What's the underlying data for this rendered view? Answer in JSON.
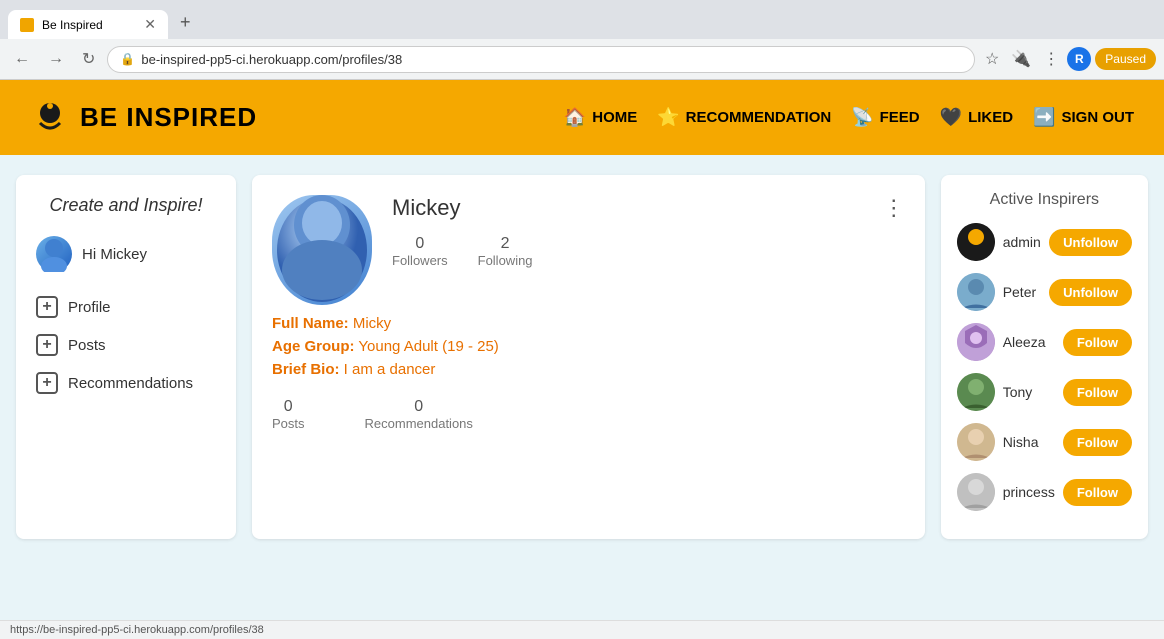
{
  "browser": {
    "tab_title": "Be Inspired",
    "tab_favicon": "🏠",
    "url": "be-inspired-pp5-ci.herokuapp.com/profiles/38",
    "new_tab_label": "+",
    "nav_back": "←",
    "nav_forward": "→",
    "nav_refresh": "↻",
    "status_url": "https://be-inspired-pp5-ci.herokuapp.com/profiles/38",
    "profile_letter": "R",
    "paused_label": "Paused"
  },
  "navbar": {
    "logo_text": "BE INSPIRED",
    "nav_items": [
      {
        "id": "home",
        "icon": "🏠",
        "label": "HOME"
      },
      {
        "id": "recommendation",
        "icon": "⭐",
        "label": "RECOMMENDATION"
      },
      {
        "id": "feed",
        "icon": "📡",
        "label": "FEED"
      },
      {
        "id": "liked",
        "icon": "🖤",
        "label": "LIKED"
      },
      {
        "id": "signout",
        "icon": "🚪",
        "label": "SIGN OUT"
      }
    ]
  },
  "sidebar": {
    "title": "Create and Inspire!",
    "user_greeting": "Hi Mickey",
    "menu_items": [
      {
        "id": "profile",
        "label": "Profile"
      },
      {
        "id": "posts",
        "label": "Posts"
      },
      {
        "id": "recommendations",
        "label": "Recommendations"
      }
    ]
  },
  "profile": {
    "name": "Mickey",
    "followers_count": "0",
    "followers_label": "Followers",
    "following_count": "2",
    "following_label": "Following",
    "full_name_label": "Full Name:",
    "full_name_value": "Micky",
    "age_group_label": "Age Group:",
    "age_group_value": "Young Adult (19 - 25)",
    "bio_label": "Brief Bio:",
    "bio_value": "I am a dancer",
    "posts_count": "0",
    "posts_label": "Posts",
    "recommendations_count": "0",
    "recommendations_label": "Recommendations"
  },
  "inspirers": {
    "title": "Active Inspirers",
    "items": [
      {
        "id": "admin",
        "name": "admin",
        "button_label": "Unfollow",
        "button_type": "unfollow"
      },
      {
        "id": "peter",
        "name": "Peter",
        "button_label": "Unfollow",
        "button_type": "unfollow"
      },
      {
        "id": "aleeza",
        "name": "Aleeza",
        "button_label": "Follow",
        "button_type": "follow"
      },
      {
        "id": "tony",
        "name": "Tony",
        "button_label": "Follow",
        "button_type": "follow"
      },
      {
        "id": "nisha",
        "name": "Nisha",
        "button_label": "Follow",
        "button_type": "follow"
      },
      {
        "id": "princess",
        "name": "princess",
        "button_label": "Follow",
        "button_type": "follow"
      }
    ]
  }
}
